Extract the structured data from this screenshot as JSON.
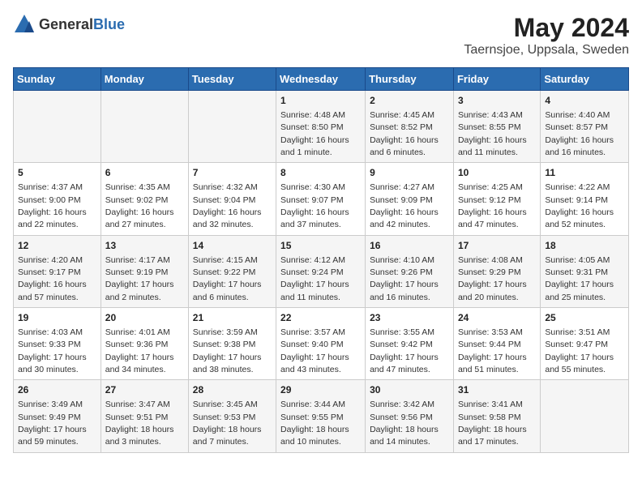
{
  "header": {
    "logo_general": "General",
    "logo_blue": "Blue",
    "title": "May 2024",
    "subtitle": "Taernsjoe, Uppsala, Sweden"
  },
  "days_of_week": [
    "Sunday",
    "Monday",
    "Tuesday",
    "Wednesday",
    "Thursday",
    "Friday",
    "Saturday"
  ],
  "weeks": [
    [
      {
        "day": "",
        "info": ""
      },
      {
        "day": "",
        "info": ""
      },
      {
        "day": "",
        "info": ""
      },
      {
        "day": "1",
        "info": "Sunrise: 4:48 AM\nSunset: 8:50 PM\nDaylight: 16 hours and 1 minute."
      },
      {
        "day": "2",
        "info": "Sunrise: 4:45 AM\nSunset: 8:52 PM\nDaylight: 16 hours and 6 minutes."
      },
      {
        "day": "3",
        "info": "Sunrise: 4:43 AM\nSunset: 8:55 PM\nDaylight: 16 hours and 11 minutes."
      },
      {
        "day": "4",
        "info": "Sunrise: 4:40 AM\nSunset: 8:57 PM\nDaylight: 16 hours and 16 minutes."
      }
    ],
    [
      {
        "day": "5",
        "info": "Sunrise: 4:37 AM\nSunset: 9:00 PM\nDaylight: 16 hours and 22 minutes."
      },
      {
        "day": "6",
        "info": "Sunrise: 4:35 AM\nSunset: 9:02 PM\nDaylight: 16 hours and 27 minutes."
      },
      {
        "day": "7",
        "info": "Sunrise: 4:32 AM\nSunset: 9:04 PM\nDaylight: 16 hours and 32 minutes."
      },
      {
        "day": "8",
        "info": "Sunrise: 4:30 AM\nSunset: 9:07 PM\nDaylight: 16 hours and 37 minutes."
      },
      {
        "day": "9",
        "info": "Sunrise: 4:27 AM\nSunset: 9:09 PM\nDaylight: 16 hours and 42 minutes."
      },
      {
        "day": "10",
        "info": "Sunrise: 4:25 AM\nSunset: 9:12 PM\nDaylight: 16 hours and 47 minutes."
      },
      {
        "day": "11",
        "info": "Sunrise: 4:22 AM\nSunset: 9:14 PM\nDaylight: 16 hours and 52 minutes."
      }
    ],
    [
      {
        "day": "12",
        "info": "Sunrise: 4:20 AM\nSunset: 9:17 PM\nDaylight: 16 hours and 57 minutes."
      },
      {
        "day": "13",
        "info": "Sunrise: 4:17 AM\nSunset: 9:19 PM\nDaylight: 17 hours and 2 minutes."
      },
      {
        "day": "14",
        "info": "Sunrise: 4:15 AM\nSunset: 9:22 PM\nDaylight: 17 hours and 6 minutes."
      },
      {
        "day": "15",
        "info": "Sunrise: 4:12 AM\nSunset: 9:24 PM\nDaylight: 17 hours and 11 minutes."
      },
      {
        "day": "16",
        "info": "Sunrise: 4:10 AM\nSunset: 9:26 PM\nDaylight: 17 hours and 16 minutes."
      },
      {
        "day": "17",
        "info": "Sunrise: 4:08 AM\nSunset: 9:29 PM\nDaylight: 17 hours and 20 minutes."
      },
      {
        "day": "18",
        "info": "Sunrise: 4:05 AM\nSunset: 9:31 PM\nDaylight: 17 hours and 25 minutes."
      }
    ],
    [
      {
        "day": "19",
        "info": "Sunrise: 4:03 AM\nSunset: 9:33 PM\nDaylight: 17 hours and 30 minutes."
      },
      {
        "day": "20",
        "info": "Sunrise: 4:01 AM\nSunset: 9:36 PM\nDaylight: 17 hours and 34 minutes."
      },
      {
        "day": "21",
        "info": "Sunrise: 3:59 AM\nSunset: 9:38 PM\nDaylight: 17 hours and 38 minutes."
      },
      {
        "day": "22",
        "info": "Sunrise: 3:57 AM\nSunset: 9:40 PM\nDaylight: 17 hours and 43 minutes."
      },
      {
        "day": "23",
        "info": "Sunrise: 3:55 AM\nSunset: 9:42 PM\nDaylight: 17 hours and 47 minutes."
      },
      {
        "day": "24",
        "info": "Sunrise: 3:53 AM\nSunset: 9:44 PM\nDaylight: 17 hours and 51 minutes."
      },
      {
        "day": "25",
        "info": "Sunrise: 3:51 AM\nSunset: 9:47 PM\nDaylight: 17 hours and 55 minutes."
      }
    ],
    [
      {
        "day": "26",
        "info": "Sunrise: 3:49 AM\nSunset: 9:49 PM\nDaylight: 17 hours and 59 minutes."
      },
      {
        "day": "27",
        "info": "Sunrise: 3:47 AM\nSunset: 9:51 PM\nDaylight: 18 hours and 3 minutes."
      },
      {
        "day": "28",
        "info": "Sunrise: 3:45 AM\nSunset: 9:53 PM\nDaylight: 18 hours and 7 minutes."
      },
      {
        "day": "29",
        "info": "Sunrise: 3:44 AM\nSunset: 9:55 PM\nDaylight: 18 hours and 10 minutes."
      },
      {
        "day": "30",
        "info": "Sunrise: 3:42 AM\nSunset: 9:56 PM\nDaylight: 18 hours and 14 minutes."
      },
      {
        "day": "31",
        "info": "Sunrise: 3:41 AM\nSunset: 9:58 PM\nDaylight: 18 hours and 17 minutes."
      },
      {
        "day": "",
        "info": ""
      }
    ]
  ]
}
